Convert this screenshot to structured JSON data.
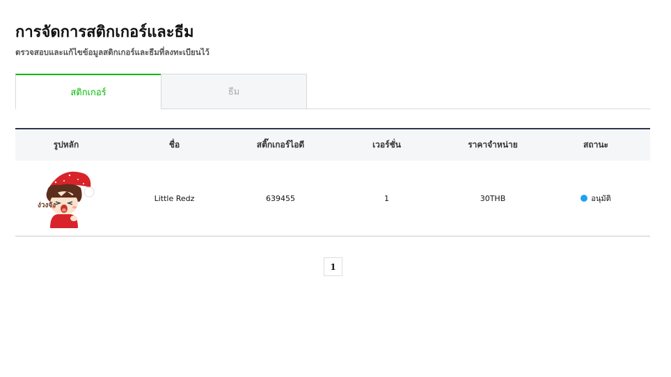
{
  "header": {
    "title": "การจัดการสติกเกอร์และธีม",
    "subtitle": "ตรวจสอบและแก้ไขข้อมูลสติกเกอร์และธีมที่ลงทะเบียนไว้"
  },
  "tabs": [
    {
      "label": "สติกเกอร์",
      "active": true
    },
    {
      "label": "ธีม",
      "active": false
    }
  ],
  "table": {
    "headers": [
      "รูปหลัก",
      "ชื่อ",
      "สติ๊กเกอร์ไอดี",
      "เวอร์ชั่น",
      "ราคาจำหน่าย",
      "สถานะ"
    ],
    "rows": [
      {
        "image_icon": "sticker-thumbnail-santa-boy",
        "image_text": "ง่วงจัง",
        "name": "Little Redz",
        "sticker_id": "639455",
        "version": "1",
        "price": "30THB",
        "status": "อนุมัติ",
        "status_color": "#1ea1f2"
      }
    ]
  },
  "pagination": {
    "current_page": "1"
  },
  "colors": {
    "accent": "#00b900",
    "table_top_border": "#2c3349"
  }
}
